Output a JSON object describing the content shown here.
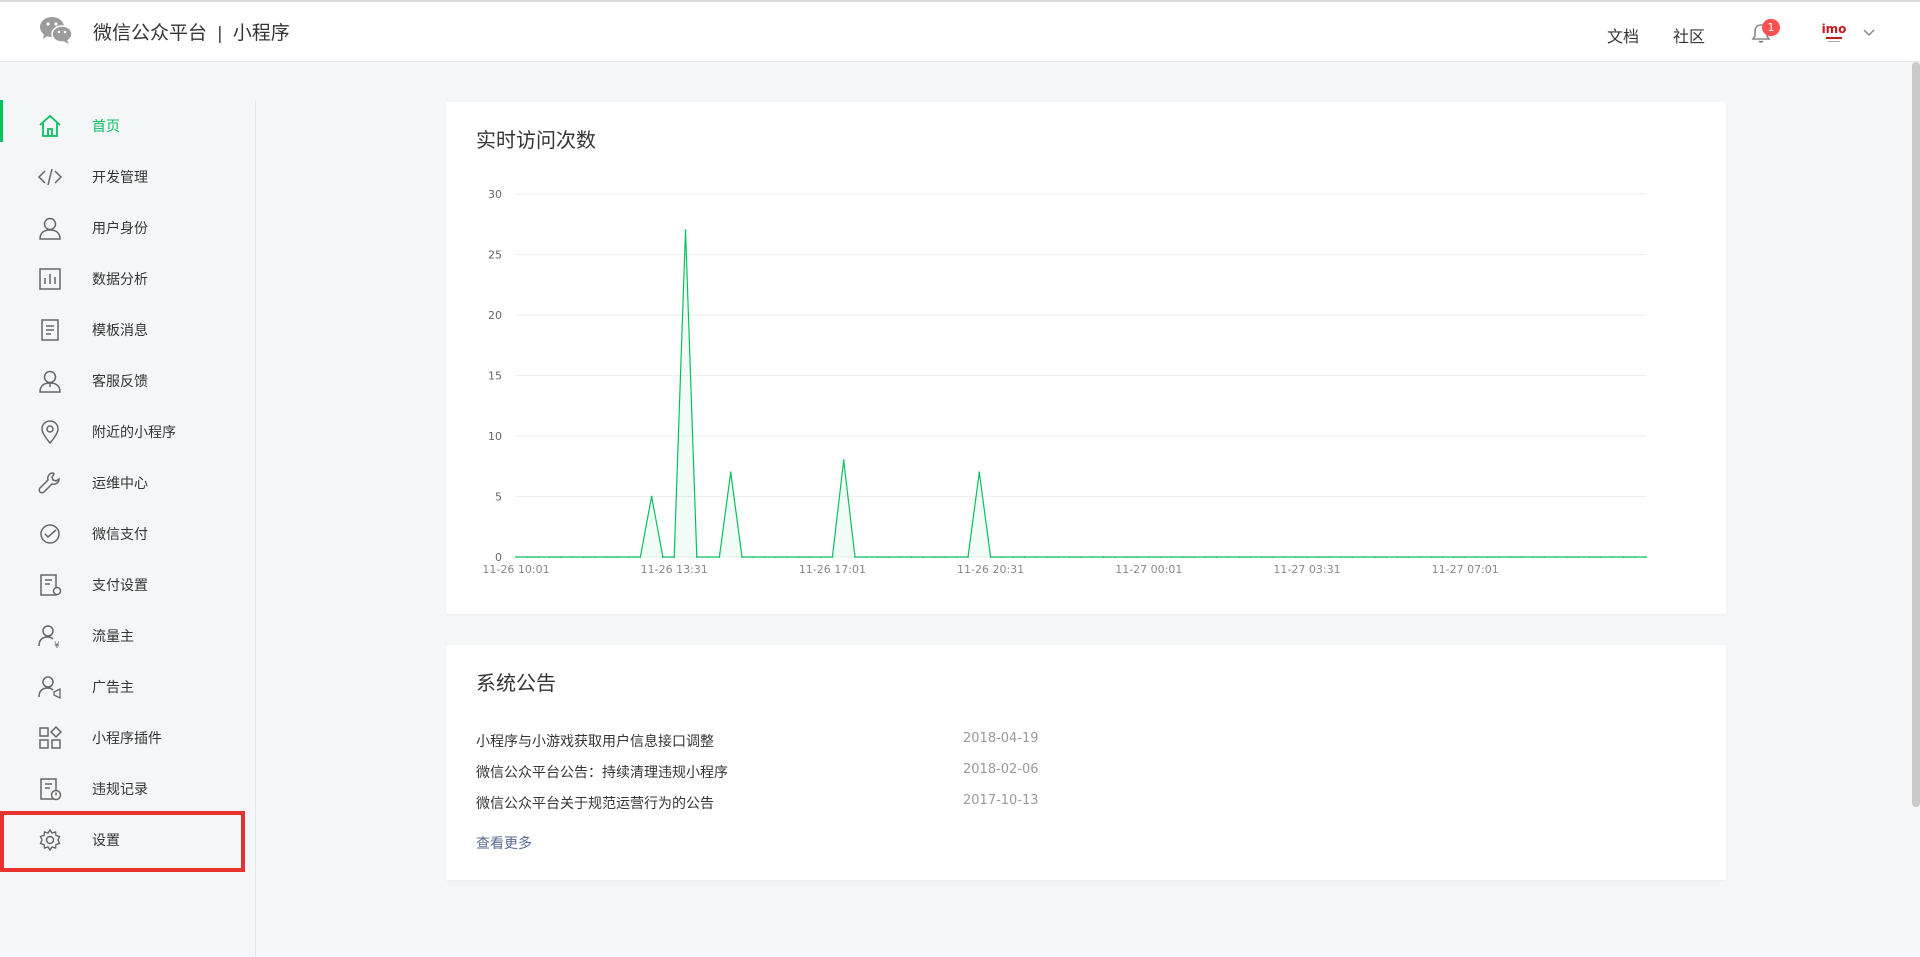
{
  "header": {
    "brand": "微信公众平台",
    "separator": "|",
    "product": "小程序",
    "links": [
      "文档",
      "社区"
    ],
    "notification_count": "1",
    "icons": {
      "logo": "wechat-logo-icon",
      "bell": "bell-icon",
      "avatar": "account-avatar",
      "chevron": "chevron-down-icon"
    }
  },
  "sidebar": {
    "items": [
      {
        "label": "首页",
        "icon": "home-icon",
        "active": true
      },
      {
        "label": "开发管理",
        "icon": "code-icon"
      },
      {
        "label": "用户身份",
        "icon": "user-icon"
      },
      {
        "label": "数据分析",
        "icon": "bar-chart-icon"
      },
      {
        "label": "模板消息",
        "icon": "document-icon"
      },
      {
        "label": "客服反馈",
        "icon": "headset-user-icon"
      },
      {
        "label": "附近的小程序",
        "icon": "location-pin-icon"
      },
      {
        "label": "运维中心",
        "icon": "wrench-icon"
      },
      {
        "label": "微信支付",
        "icon": "payment-icon"
      },
      {
        "label": "支付设置",
        "icon": "payment-settings-icon"
      },
      {
        "label": "流量主",
        "icon": "user-yen-icon"
      },
      {
        "label": "广告主",
        "icon": "user-megaphone-icon"
      },
      {
        "label": "小程序插件",
        "icon": "plugin-grid-icon"
      },
      {
        "label": "违规记录",
        "icon": "violation-record-icon"
      },
      {
        "label": "设置",
        "icon": "gear-icon"
      }
    ],
    "accent_color": "#07c160",
    "highlight_color": "#e8322d"
  },
  "realtime": {
    "title": "实时访问次数"
  },
  "chart_data": {
    "type": "area",
    "title": "实时访问次数",
    "x_tick_labels": [
      "11-26 10:01",
      "11-26 13:31",
      "11-26 17:01",
      "11-26 20:31",
      "11-27 00:01",
      "11-27 03:31",
      "11-27 07:01"
    ],
    "y_ticks": [
      0,
      5,
      10,
      15,
      20,
      25,
      30
    ],
    "ylim": [
      0,
      30
    ],
    "x_start": "11-26 10:01",
    "x_step_minutes": 15,
    "points_count": 101,
    "series": [
      {
        "color": "#07c160",
        "nonzero": [
          {
            "x": "11-26 13:01",
            "y": 5
          },
          {
            "x": "11-26 13:46",
            "y": 27
          },
          {
            "x": "11-26 14:46",
            "y": 7
          },
          {
            "x": "11-26 17:16",
            "y": 8
          },
          {
            "x": "11-26 20:16",
            "y": 7
          }
        ]
      }
    ],
    "grid": true
  },
  "notices": {
    "title": "系统公告",
    "items": [
      {
        "title": "小程序与小游戏获取用户信息接口调整",
        "date": "2018-04-19"
      },
      {
        "title": "微信公众平台公告：持续清理违规小程序",
        "date": "2018-02-06"
      },
      {
        "title": "微信公众平台关于规范运营行为的公告",
        "date": "2017-10-13"
      }
    ],
    "more": "查看更多"
  }
}
